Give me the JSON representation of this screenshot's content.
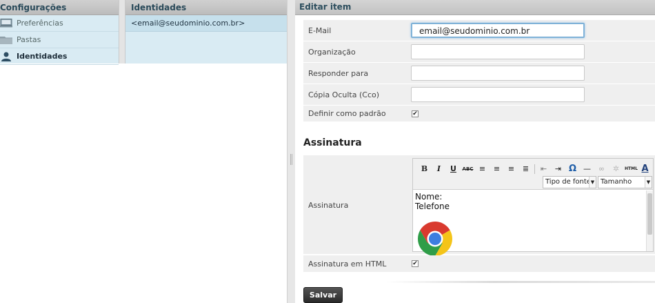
{
  "settings": {
    "title": "Configurações",
    "items": [
      {
        "label": "Preferências",
        "icon": "monitor-icon"
      },
      {
        "label": "Pastas",
        "icon": "folder-icon"
      },
      {
        "label": "Identidades",
        "icon": "user-icon"
      }
    ]
  },
  "identities": {
    "title": "Identidades",
    "rows": [
      "<email@seudominio.com.br>"
    ]
  },
  "edit": {
    "title": "Editar item",
    "fields": [
      {
        "label": "E-Mail",
        "value": "email@seudominio.com.br"
      },
      {
        "label": "Organização",
        "value": ""
      },
      {
        "label": "Responder para",
        "value": ""
      },
      {
        "label": "Cópia Oculta (Cco)",
        "value": ""
      }
    ],
    "default_label": "Definir como padrão",
    "default_checked": true,
    "signature_section": "Assinatura",
    "signature_label": "Assinatura",
    "toolbar": {
      "font_type": "Tipo de fonte",
      "font_size": "Tamanho"
    },
    "signature_text": [
      "Nome:",
      "Telefone"
    ],
    "html_label": "Assinatura em HTML",
    "html_checked": true,
    "save_label": "Salvar"
  },
  "colors": {
    "nav_bg": "#d9ebf3",
    "row_bg": "#efefef",
    "focus": "#7fb2d8",
    "button": "#2a2a2a"
  }
}
